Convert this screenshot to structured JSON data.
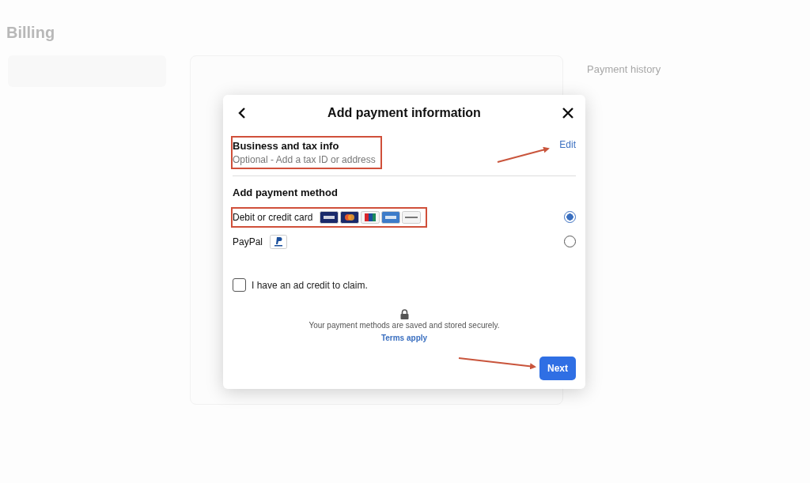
{
  "background": {
    "page_title": "Billing",
    "side_heading": "Payment history"
  },
  "dialog": {
    "title": "Add payment information",
    "business": {
      "title": "Business and tax info",
      "subtitle": "Optional - Add a tax ID or address",
      "action": "Edit",
      "highlighted": true
    },
    "method_heading": "Add payment method",
    "methods": [
      {
        "label": "Debit or credit card",
        "kind": "cards",
        "selected": true,
        "highlighted": true
      },
      {
        "label": "PayPal",
        "kind": "paypal",
        "selected": false,
        "highlighted": false
      }
    ],
    "credit": {
      "label": "I have an ad credit to claim.",
      "checked": false
    },
    "security_note": "Your payment methods are saved and stored securely.",
    "terms_link": "Terms apply",
    "next_button": "Next"
  }
}
